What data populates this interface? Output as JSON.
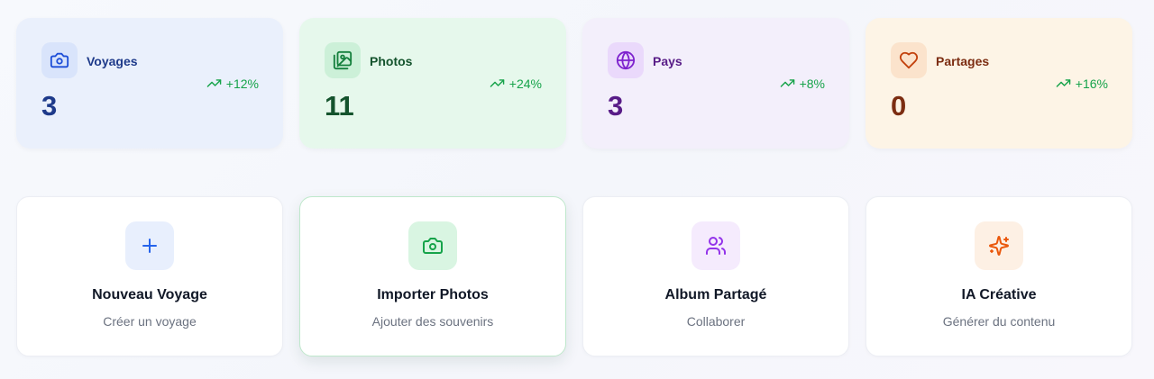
{
  "stats": [
    {
      "label": "Voyages",
      "value": "3",
      "trend": "+12%",
      "icon": "camera-icon",
      "bg": "#eaf0fc",
      "icon_bg": "#d9e4fb",
      "accent": "#1e3a8a",
      "icon_color": "#1d4ed8"
    },
    {
      "label": "Photos",
      "value": "11",
      "trend": "+24%",
      "icon": "image-gallery-icon",
      "bg": "#e6f8ec",
      "icon_bg": "#ccf0d8",
      "accent": "#14532d",
      "icon_color": "#15803d"
    },
    {
      "label": "Pays",
      "value": "3",
      "trend": "+8%",
      "icon": "globe-icon",
      "bg": "#f3effb",
      "icon_bg": "#ead9fb",
      "accent": "#581c87",
      "icon_color": "#7e22ce"
    },
    {
      "label": "Partages",
      "value": "0",
      "trend": "+16%",
      "icon": "heart-icon",
      "bg": "#fdf4e6",
      "icon_bg": "#fbe3cc",
      "accent": "#7c2d12",
      "icon_color": "#c2410c"
    }
  ],
  "actions": [
    {
      "title": "Nouveau Voyage",
      "subtitle": "Créer un voyage",
      "icon": "plus-icon",
      "icon_bg": "#e8effd",
      "icon_color": "#2563eb"
    },
    {
      "title": "Importer Photos",
      "subtitle": "Ajouter des souvenirs",
      "icon": "camera-icon",
      "icon_bg": "#d9f5e2",
      "icon_color": "#16a34a"
    },
    {
      "title": "Album Partagé",
      "subtitle": "Collaborer",
      "icon": "users-icon",
      "icon_bg": "#f5ebfd",
      "icon_color": "#9333ea"
    },
    {
      "title": "IA Créative",
      "subtitle": "Générer du contenu",
      "icon": "sparkles-icon",
      "icon_bg": "#fdf0e4",
      "icon_color": "#ea580c"
    }
  ],
  "trend_color": "#16a34a"
}
